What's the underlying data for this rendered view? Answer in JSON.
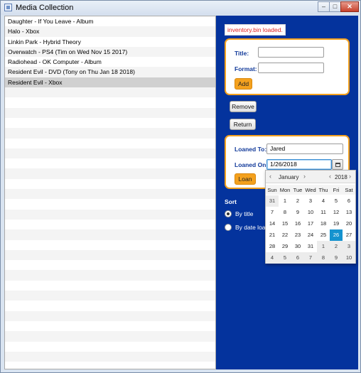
{
  "window": {
    "title": "Media Collection",
    "min": "–",
    "max": "□",
    "close": "✕"
  },
  "media_list": [
    "Daughter - If You Leave - Album",
    "Halo - Xbox",
    "Linkin Park - Hybrid Theory",
    "Overwatch - PS4 (Tim on Wed Nov 15 2017)",
    "Radiohead - OK Computer - Album",
    "Resident Evil - DVD (Tony on Thu Jan 18 2018)",
    "Resident Evil - Xbox"
  ],
  "selected_index": 6,
  "status_message": "inventory.bin loaded.",
  "add_form": {
    "title_label": "Title:",
    "title_value": "",
    "format_label": "Format:",
    "format_value": "",
    "add_button": "Add"
  },
  "remove_button": "Remove",
  "return_button": "Return",
  "loan_form": {
    "loaned_to_label": "Loaned To:",
    "loaned_to_value": "Jared",
    "loaned_on_label": "Loaned On:",
    "loaned_on_value": "1/26/2018",
    "loan_button": "Loan"
  },
  "sort": {
    "title": "Sort",
    "by_title": "By title",
    "by_date": "By date loaned",
    "selected": "By title"
  },
  "calendar": {
    "month": "January",
    "year": "2018",
    "prev_month": "‹",
    "next_month": "›",
    "prev_year": "‹",
    "next_year": "›",
    "days_of_week": [
      "Sun",
      "Mon",
      "Tue",
      "Wed",
      "Thu",
      "Fri",
      "Sat"
    ],
    "weeks": [
      [
        "31",
        "1",
        "2",
        "3",
        "4",
        "5",
        "6"
      ],
      [
        "7",
        "8",
        "9",
        "10",
        "11",
        "12",
        "13"
      ],
      [
        "14",
        "15",
        "16",
        "17",
        "18",
        "19",
        "20"
      ],
      [
        "21",
        "22",
        "23",
        "24",
        "25",
        "26",
        "27"
      ],
      [
        "28",
        "29",
        "30",
        "31",
        "1",
        "2",
        "3"
      ],
      [
        "4",
        "5",
        "6",
        "7",
        "8",
        "9",
        "10"
      ]
    ],
    "selected_day": "26"
  },
  "colors": {
    "panel_bg": "#04339d",
    "accent_orange": "#f4a11e",
    "selected_day": "#1593cf",
    "status_red": "#e02020"
  }
}
